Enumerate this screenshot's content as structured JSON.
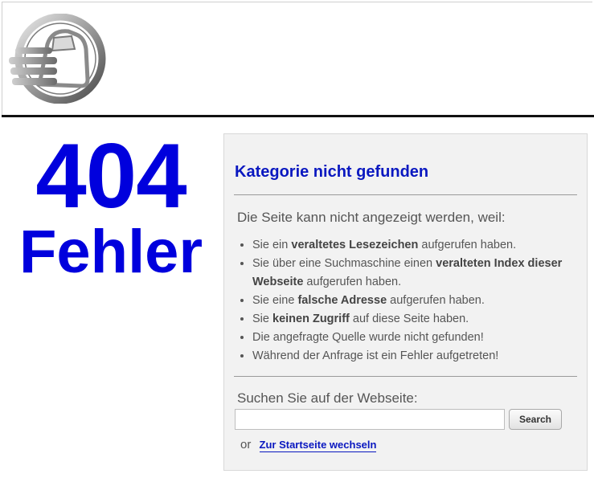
{
  "error": {
    "code": "404",
    "word": "Fehler"
  },
  "panel": {
    "title": "Kategorie nicht gefunden",
    "intro": "Die Seite kann nicht angezeigt werden, weil:",
    "reasons": [
      [
        {
          "t": "Sie ein "
        },
        {
          "t": "veraltetes Lesezeichen",
          "b": true
        },
        {
          "t": " aufgerufen haben."
        }
      ],
      [
        {
          "t": "Sie über eine Suchmaschine einen "
        },
        {
          "t": "veralteten Index dieser Webseite",
          "b": true
        },
        {
          "t": " aufgerufen haben."
        }
      ],
      [
        {
          "t": "Sie eine "
        },
        {
          "t": "falsche Adresse",
          "b": true
        },
        {
          "t": " aufgerufen haben."
        }
      ],
      [
        {
          "t": "Sie "
        },
        {
          "t": "keinen Zugriff",
          "b": true
        },
        {
          "t": " auf diese Seite haben."
        }
      ],
      [
        {
          "t": "Die angefragte Quelle wurde nicht gefunden!"
        }
      ],
      [
        {
          "t": "Während der Anfrage ist ein Fehler aufgetreten!"
        }
      ]
    ]
  },
  "search": {
    "label": "Suchen Sie auf der Webseite:",
    "value": "",
    "placeholder": "",
    "button_label": "Search"
  },
  "home": {
    "or_text": "or",
    "link_label": "Zur Startseite wechseln"
  },
  "colors": {
    "accent_blue": "#0000dd",
    "title_blue": "#0a18c0",
    "panel_bg": "#f2f2f2",
    "text_gray": "#555555"
  },
  "icons": {
    "logo": "car-logo-icon"
  }
}
